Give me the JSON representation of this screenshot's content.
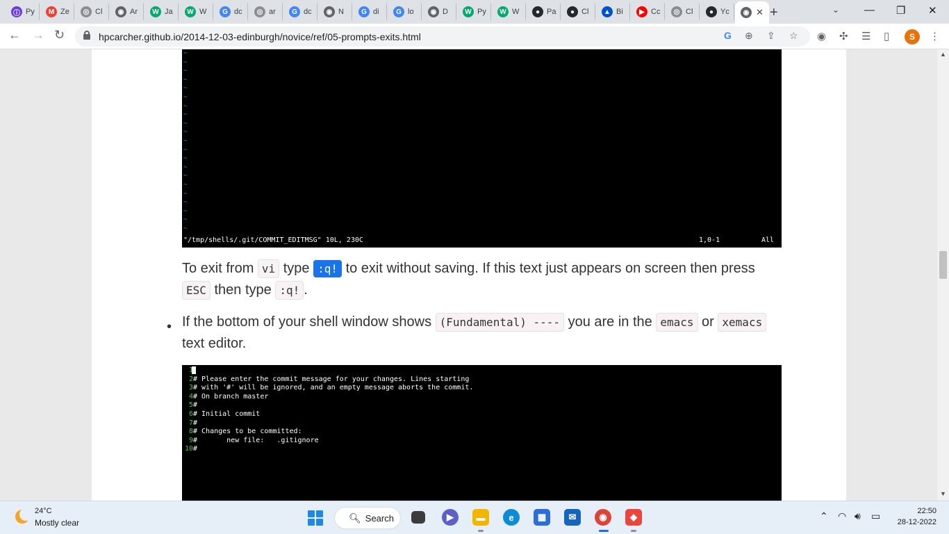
{
  "browser": {
    "tabs": [
      {
        "label": "Py",
        "icon": "python-tutor-icon",
        "color": "#6a3dd8",
        "glyph": "ⓘ"
      },
      {
        "label": "Ze",
        "icon": "gmail-icon",
        "color": "#ea4335",
        "glyph": "M"
      },
      {
        "label": "Cl",
        "icon": "classroom-icon",
        "color": "#8a8d91",
        "glyph": "◎"
      },
      {
        "label": "Ar",
        "icon": "globe-icon",
        "color": "#5f6368",
        "glyph": "◉"
      },
      {
        "label": "Ja",
        "icon": "w3schools-icon",
        "color": "#04aa6d",
        "glyph": "W"
      },
      {
        "label": "W",
        "icon": "w3schools-icon",
        "color": "#04aa6d",
        "glyph": "W"
      },
      {
        "label": "dc",
        "icon": "google-icon",
        "color": "#4285f4",
        "glyph": "G"
      },
      {
        "label": "ar",
        "icon": "classroom-icon",
        "color": "#8a8d91",
        "glyph": "◎"
      },
      {
        "label": "dc",
        "icon": "google-icon",
        "color": "#4285f4",
        "glyph": "G"
      },
      {
        "label": "N",
        "icon": "chrome-icon",
        "color": "#5f6368",
        "glyph": "◉"
      },
      {
        "label": "di",
        "icon": "google-icon",
        "color": "#4285f4",
        "glyph": "G"
      },
      {
        "label": "lo",
        "icon": "google-icon",
        "color": "#4285f4",
        "glyph": "G"
      },
      {
        "label": "D",
        "icon": "globe-icon",
        "color": "#5f6368",
        "glyph": "◉"
      },
      {
        "label": "Py",
        "icon": "w3schools-icon",
        "color": "#04aa6d",
        "glyph": "W"
      },
      {
        "label": "W",
        "icon": "w3schools-icon",
        "color": "#04aa6d",
        "glyph": "W"
      },
      {
        "label": "Pa",
        "icon": "github-icon",
        "color": "#24292f",
        "glyph": "●"
      },
      {
        "label": "Cl",
        "icon": "github-icon",
        "color": "#24292f",
        "glyph": "●"
      },
      {
        "label": "Bi",
        "icon": "atlassian-icon",
        "color": "#0052cc",
        "glyph": "▲"
      },
      {
        "label": "Cc",
        "icon": "youtube-icon",
        "color": "#ff0000",
        "glyph": "▶"
      },
      {
        "label": "Cl",
        "icon": "classroom-icon",
        "color": "#8a8d91",
        "glyph": "◎"
      },
      {
        "label": "Yc",
        "icon": "github-icon",
        "color": "#24292f",
        "glyph": "●"
      },
      {
        "label": "",
        "icon": "globe-icon",
        "color": "#5f6368",
        "glyph": "◉",
        "active": true
      }
    ],
    "url": "hpcarcher.github.io/2014-12-03-edinburgh/novice/ref/05-prompts-exits.html",
    "profile_initial": "S"
  },
  "content": {
    "vim_status": {
      "file": "\"/tmp/shells/.git/COMMIT_EDITMSG\" 10L, 230C",
      "position": "1,0-1",
      "scroll": "All"
    },
    "para1": {
      "t1": "To exit from ",
      "c1": "vi",
      "t2": " type ",
      "c2": ":q!",
      "t3": " to exit without saving. If this text just appears on screen then press ",
      "c3": "ESC",
      "t4": " then type ",
      "c4": ":q!",
      "t5": "."
    },
    "bullet": {
      "t1": "If the bottom of your shell window shows ",
      "c1": "(Fundamental) ----",
      "t2": " you are in the ",
      "c2": "emacs",
      "t3": " or ",
      "c3": "xemacs",
      "t4": " text editor."
    },
    "editor_lines": [
      {
        "num": "1",
        "text": ""
      },
      {
        "num": "2",
        "text": "# Please enter the commit message for your changes. Lines starting"
      },
      {
        "num": "3",
        "text": "# with '#' will be ignored, and an empty message aborts the commit."
      },
      {
        "num": "4",
        "text": "# On branch master"
      },
      {
        "num": "5",
        "text": "#"
      },
      {
        "num": "6",
        "text": "# Initial commit"
      },
      {
        "num": "7",
        "text": "#"
      },
      {
        "num": "8",
        "text": "# Changes to be committed:"
      },
      {
        "num": "9",
        "text": "#       new file:   .gitignore"
      },
      {
        "num": "10",
        "text": "#"
      }
    ]
  },
  "taskbar": {
    "weather_temp": "24°C",
    "weather_desc": "Mostly clear",
    "search_label": "Search",
    "time": "22:50",
    "date": "28-12-2022"
  }
}
